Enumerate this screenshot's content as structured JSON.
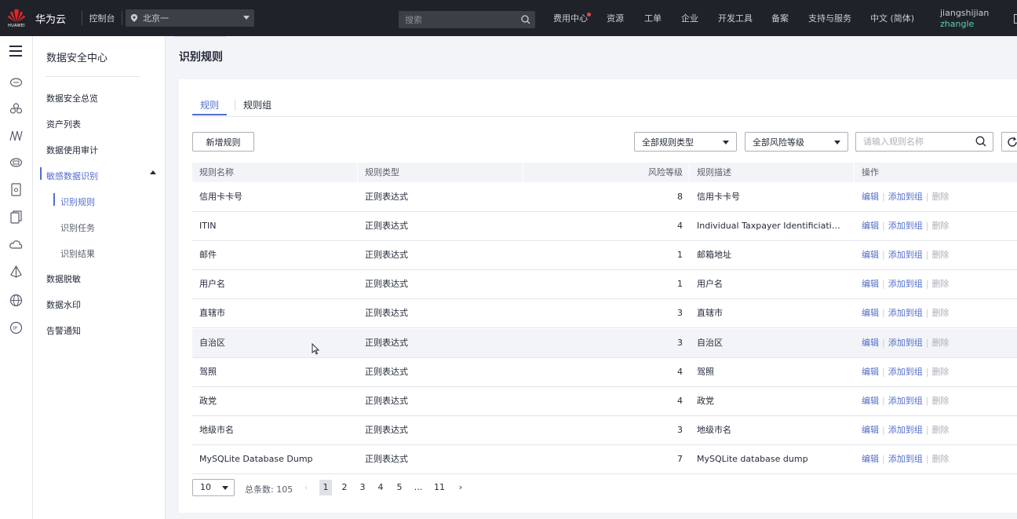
{
  "topbar": {
    "logo_text": "HUAWEI",
    "brand": "华为云",
    "console": "控制台",
    "region": "北京一",
    "search_placeholder": "搜索",
    "nav": [
      "费用中心",
      "资源",
      "工单",
      "企业",
      "开发工具",
      "备案",
      "支持与服务",
      "中文 (简体)"
    ],
    "user_name": "jiangshijian",
    "user_sub": "zhangle"
  },
  "sidebar": {
    "title": "数据安全中心",
    "items": [
      "数据安全总览",
      "资产列表",
      "数据使用审计",
      "敏感数据识别",
      "数据脱敏",
      "数据水印",
      "告警通知"
    ],
    "subitems": [
      "识别规则",
      "识别任务",
      "识别结果"
    ]
  },
  "page": {
    "title": "识别规则",
    "tabs": [
      "规则",
      "规则组"
    ]
  },
  "toolbar": {
    "add_label": "新增规则",
    "type_filter": "全部规则类型",
    "risk_filter": "全部风险等级",
    "name_placeholder": "请输入规则名称"
  },
  "table": {
    "headers": [
      "规则名称",
      "规则类型",
      "风险等级",
      "规则描述",
      "操作"
    ],
    "rows": [
      {
        "name": "信用卡卡号",
        "type": "正则表达式",
        "level": "8",
        "desc": "信用卡卡号"
      },
      {
        "name": "ITIN",
        "type": "正则表达式",
        "level": "4",
        "desc": "Individual Taxpayer Identificiation Nu..."
      },
      {
        "name": "邮件",
        "type": "正则表达式",
        "level": "1",
        "desc": "邮箱地址"
      },
      {
        "name": "用户名",
        "type": "正则表达式",
        "level": "1",
        "desc": "用户名"
      },
      {
        "name": "直辖市",
        "type": "正则表达式",
        "level": "3",
        "desc": "直辖市"
      },
      {
        "name": "自治区",
        "type": "正则表达式",
        "level": "3",
        "desc": "自治区"
      },
      {
        "name": "驾照",
        "type": "正则表达式",
        "level": "4",
        "desc": "驾照"
      },
      {
        "name": "政党",
        "type": "正则表达式",
        "level": "4",
        "desc": "政党"
      },
      {
        "name": "地级市名",
        "type": "正则表达式",
        "level": "3",
        "desc": "地级市名"
      },
      {
        "name": "MySQLite Database Dump",
        "type": "正则表达式",
        "level": "7",
        "desc": "MySQLite database dump"
      }
    ],
    "ops": {
      "edit": "编辑",
      "add_to_group": "添加到组",
      "delete": "删除"
    }
  },
  "pagination": {
    "page_size": "10",
    "total_label": "总条数: 105",
    "pages": [
      "1",
      "2",
      "3",
      "4",
      "5",
      "...",
      "11"
    ],
    "current": "1"
  },
  "colors": {
    "accent": "#526ecc",
    "topbar": "#1f2329",
    "user_sub": "#5fd0a8"
  }
}
